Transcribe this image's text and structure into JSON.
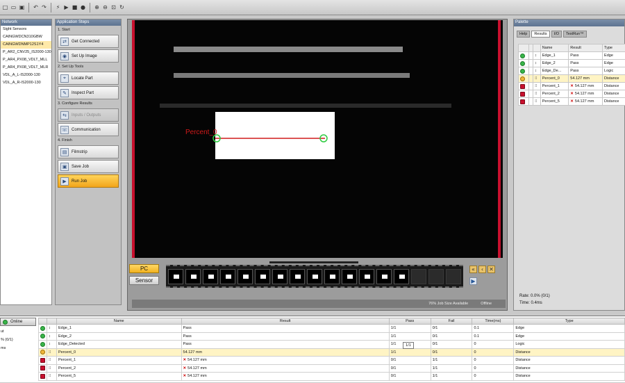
{
  "toolbar": {
    "icons": [
      "new-icon",
      "open-icon",
      "save-icon",
      "undo-icon",
      "redo-icon",
      "trigger-icon",
      "play-icon",
      "stop-icon",
      "record-icon",
      "zoom-in-icon",
      "zoom-out-icon",
      "zoom-fit-icon",
      "refresh-icon"
    ]
  },
  "network": {
    "title": "Network",
    "items": [
      "Sight Sensors",
      "CAINGWDCN310GBW",
      "CAINGWDNMP12S1Y4",
      "P_AR2_CNV25_IS2000-130",
      "P_AR4_PX08_VDLT_MLL",
      "P_AR4_PX08_VDLT_MLR",
      "VDL_A_L-IS2000-130",
      "VDL_A_R-IS2000-130"
    ],
    "selected_index": 2
  },
  "steps": {
    "title": "Application Steps",
    "sections": [
      {
        "label": "1. Start",
        "buttons": [
          {
            "label": "Get Connected",
            "icon": "connect-icon"
          },
          {
            "label": "Set Up Image",
            "icon": "camera-icon"
          }
        ]
      },
      {
        "label": "2. Set Up Tools",
        "buttons": [
          {
            "label": "Locate Part",
            "icon": "locate-icon"
          },
          {
            "label": "Inspect Part",
            "icon": "inspect-icon"
          }
        ]
      },
      {
        "label": "3. Configure Results",
        "buttons": [
          {
            "label": "Inputs / Outputs",
            "icon": "io-icon",
            "disabled": true
          },
          {
            "label": "Communication",
            "icon": "communication-icon"
          }
        ]
      },
      {
        "label": "4. Finish",
        "buttons": [
          {
            "label": "Filmstrip",
            "icon": "filmstrip-icon"
          },
          {
            "label": "Save Job",
            "icon": "save-icon"
          },
          {
            "label": "Run Job",
            "icon": "run-icon",
            "active": true
          }
        ]
      }
    ]
  },
  "image": {
    "overlay_label": "Percent_0"
  },
  "view_buttons": {
    "pc": "PC",
    "sensor": "Sensor"
  },
  "filmstrip": {
    "thumb_count": 14,
    "empty_count": 3
  },
  "status": {
    "job_size": "76% Job Size Available",
    "mode": "Offline"
  },
  "palette": {
    "title": "Palette",
    "tabs": [
      "Help",
      "Results",
      "I/O",
      "TestRun™"
    ],
    "active_tab": "Results",
    "columns": [
      "Name",
      "Result",
      "Type"
    ],
    "rows": [
      {
        "status": "pass",
        "name": "Edge_1",
        "result": "Pass",
        "type": "Edge"
      },
      {
        "status": "pass",
        "name": "Edge_2",
        "result": "Pass",
        "type": "Edge"
      },
      {
        "status": "pass",
        "name": "Edge_De...",
        "result": "Pass",
        "type": "Logic"
      },
      {
        "status": "pass-highlight",
        "name": "Percent_0",
        "result": "54.127 mm",
        "type": "Distance"
      },
      {
        "status": "fail",
        "name": "Percent_1",
        "result": "54.127 mm",
        "type": "Distance"
      },
      {
        "status": "fail",
        "name": "Percent_2",
        "result": "54.127 mm",
        "type": "Distance"
      },
      {
        "status": "fail",
        "name": "Percent_5",
        "result": "54.127 mm",
        "type": "Distance"
      }
    ],
    "rate": "Rate: 0.0% (0/1)",
    "time": "Time: 0.4ms"
  },
  "bottom": {
    "online": "Online",
    "left_lines": [
      "ut",
      "% (0/1)",
      "ms"
    ],
    "columns": [
      "",
      "",
      "Name",
      "Result",
      "Pass",
      "Fail",
      "Time(ms)",
      "Type"
    ],
    "rows": [
      {
        "status": "pass",
        "name": "Edge_1",
        "result": "Pass",
        "pass": "1/1",
        "fail": "0/1",
        "time": "0.1",
        "type": "Edge"
      },
      {
        "status": "pass",
        "name": "Edge_2",
        "result": "Pass",
        "pass": "1/1",
        "fail": "0/1",
        "time": "0.1",
        "type": "Edge"
      },
      {
        "status": "pass",
        "name": "Edge_Detected",
        "result": "Pass",
        "pass": "1/1",
        "fail": "0/1",
        "time": "0",
        "type": "Logic"
      },
      {
        "status": "pass-highlight",
        "name": "Percent_0",
        "result": "54.127 mm",
        "pass": "1/1",
        "fail": "0/1",
        "time": "0",
        "type": "Distance"
      },
      {
        "status": "fail",
        "name": "Percent_1",
        "result": "54.127 mm",
        "pass": "0/1",
        "fail": "1/1",
        "time": "0",
        "type": "Distance"
      },
      {
        "status": "fail",
        "name": "Percent_2",
        "result": "54.127 mm",
        "pass": "0/1",
        "fail": "1/1",
        "time": "0",
        "type": "Distance"
      },
      {
        "status": "fail",
        "name": "Percent_5",
        "result": "54.127 mm",
        "pass": "0/1",
        "fail": "1/1",
        "time": "0",
        "type": "Distance"
      }
    ],
    "tooltip": "1/1"
  },
  "colors": {
    "accent": "#f2b21f",
    "pass": "#39b54a",
    "fail": "#c8102e",
    "measure_line": "#d11a1a"
  }
}
